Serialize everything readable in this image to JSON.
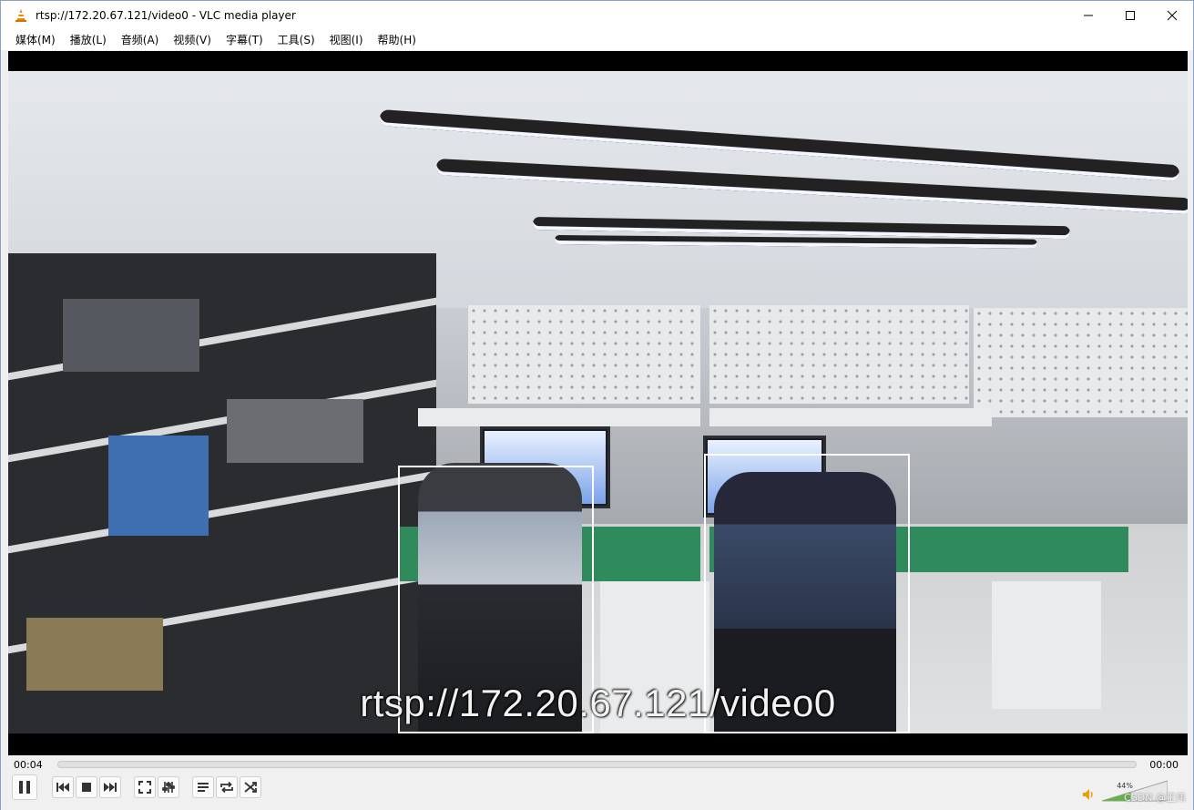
{
  "window": {
    "title": "rtsp://172.20.67.121/video0 - VLC media player",
    "app_icon": "vlc-cone-icon"
  },
  "window_controls": {
    "minimize": "—",
    "maximize": "☐",
    "close": "✕"
  },
  "menu": {
    "items": [
      {
        "label": "媒体(M)"
      },
      {
        "label": "播放(L)"
      },
      {
        "label": "音频(A)"
      },
      {
        "label": "视频(V)"
      },
      {
        "label": "字幕(T)"
      },
      {
        "label": "工具(S)"
      },
      {
        "label": "视图(I)"
      },
      {
        "label": "帮助(H)"
      }
    ]
  },
  "video": {
    "overlay_text": "rtsp://172.20.67.121/video0"
  },
  "playback": {
    "elapsed": "00:04",
    "remaining": "00:00",
    "progress": 0.0
  },
  "volume": {
    "percent_label": "44%",
    "level": 0.44
  },
  "watermark": "CSDN @王伟",
  "colors": {
    "accent": "#1a56c8",
    "detect_box": "#ffffff"
  },
  "buttons": [
    {
      "name": "pause-button",
      "icon": "pause-icon"
    },
    {
      "name": "previous-button",
      "icon": "skip-previous-icon"
    },
    {
      "name": "stop-button",
      "icon": "stop-icon"
    },
    {
      "name": "next-button",
      "icon": "skip-next-icon"
    },
    {
      "name": "fullscreen-button",
      "icon": "fullscreen-icon"
    },
    {
      "name": "extended-settings-button",
      "icon": "equalizer-icon"
    },
    {
      "name": "playlist-button",
      "icon": "playlist-icon"
    },
    {
      "name": "loop-button",
      "icon": "loop-icon"
    },
    {
      "name": "random-button",
      "icon": "shuffle-icon"
    }
  ]
}
